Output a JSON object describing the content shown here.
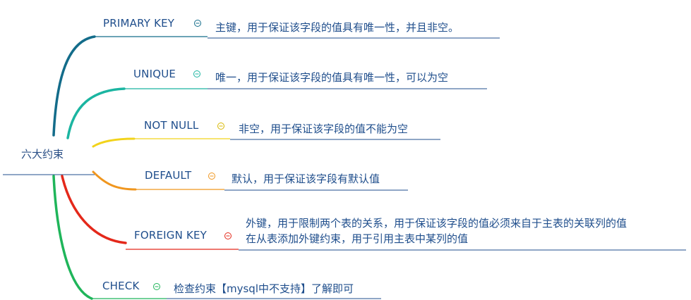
{
  "root": {
    "label": "六大约束"
  },
  "branches": [
    {
      "key": "primary",
      "label": "PRIMARY KEY",
      "desc": [
        "主键，用于保证该字段的值具有唯一性，并且非空。"
      ],
      "color": "#136c8a"
    },
    {
      "key": "unique",
      "label": "UNIQUE",
      "desc": [
        "唯一，用于保证该字段的值具有唯一性，可以为空"
      ],
      "color": "#1bb5a1"
    },
    {
      "key": "notnull",
      "label": "NOT NULL",
      "desc": [
        "非空，用于保证该字段的值不能为空"
      ],
      "color": "#f2d31b"
    },
    {
      "key": "default",
      "label": "DEFAULT",
      "desc": [
        "默认，用于保证该字段有默认值"
      ],
      "color": "#f0961e"
    },
    {
      "key": "foreign",
      "label": "FOREIGN KEY",
      "desc": [
        "外键，用于限制两个表的关系，用于保证该字段的值必须来自于主表的关联列的值",
        "在从表添加外键约束，用于引用主表中某列的值"
      ],
      "color": "#e4281a"
    },
    {
      "key": "check",
      "label": "CHECK",
      "desc": [
        "检查约束【mysql中不支持】了解即可"
      ],
      "color": "#1fb55a"
    }
  ],
  "colors": {
    "root_line": "#1f4e8c",
    "desc_line": "#1f4e8c",
    "text": "#1f4e8c"
  },
  "icons": {
    "collapse": "minus-circle-icon"
  }
}
